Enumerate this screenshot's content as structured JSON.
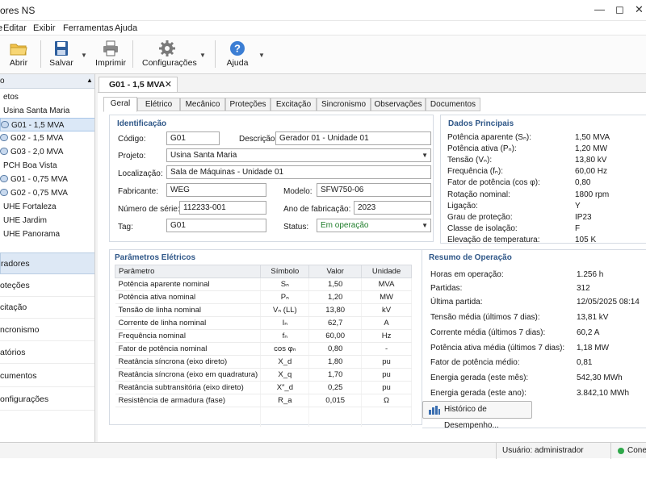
{
  "window": {
    "title": "ores NS"
  },
  "menu": [
    "Editar",
    "Exibir",
    "Ferramentas",
    "Ajuda"
  ],
  "menu_partial": "e",
  "toolbar": {
    "abrir": "Abrir",
    "salvar": "Salvar",
    "imprimir": "Imprimir",
    "config": "Configurações",
    "ajuda": "Ajuda"
  },
  "sidebar": {
    "tree": [
      "etos",
      "Usina Santa Maria",
      "G01 - 1,5 MVA",
      "G02 - 1,5 MVA",
      "G03 - 2,0 MVA",
      "PCH Boa Vista",
      "G01 - 0,75 MVA",
      "G02 - 0,75 MVA",
      "UHE Fortaleza",
      "UHE Jardim",
      "UHE Panorama"
    ],
    "nav": [
      "radores",
      "oteções",
      "citação",
      "ncronismo",
      "atórios",
      "cumentos",
      "onfigurações"
    ]
  },
  "doc_tab": {
    "label": "G01 - 1,5 MVA"
  },
  "tabs": [
    "Geral",
    "Elétrico",
    "Mecânico",
    "Proteções",
    "Excitação",
    "Sincronismo",
    "Observações",
    "Documentos"
  ],
  "identificacao": {
    "title": "Identificação",
    "codigo_label": "Código:",
    "codigo": "G01",
    "descricao_label": "Descrição:",
    "descricao": "Gerador 01 - Unidade 01",
    "projeto_label": "Projeto:",
    "projeto": "Usina Santa Maria",
    "localizacao_label": "Localização:",
    "localizacao": "Sala de Máquinas - Unidade 01",
    "fabricante_label": "Fabricante:",
    "fabricante": "WEG",
    "modelo_label": "Modelo:",
    "modelo": "SFW750-06",
    "serie_label": "Número de série:",
    "serie": "112233-001",
    "ano_label": "Ano de fabricação:",
    "ano": "2023",
    "tag_label": "Tag:",
    "tag": "G01",
    "status_label": "Status:",
    "status": "Em operação"
  },
  "dados": {
    "title": "Dados Principais",
    "rows": [
      [
        "Potência aparente (Sₙ):",
        "1,50  MVA"
      ],
      [
        "Potência ativa (Pₙ):",
        "1,20  MW"
      ],
      [
        "Tensão (Vₙ):",
        "13,80  kV"
      ],
      [
        "Frequência (fₙ):",
        "60,00  Hz"
      ],
      [
        "Fator de potência (cos φ):",
        "0,80"
      ],
      [
        "Rotação nominal:",
        "1800  rpm"
      ],
      [
        "Ligação:",
        "Y"
      ],
      [
        "Grau de proteção:",
        "IP23"
      ],
      [
        "Classe de isolação:",
        "F"
      ],
      [
        "Elevação de temperatura:",
        "105  K"
      ]
    ]
  },
  "parametros": {
    "title": "Parâmetros Elétricos",
    "headers": [
      "Parâmetro",
      "Símbolo",
      "Valor",
      "Unidade"
    ],
    "rows": [
      [
        "Potência aparente nominal",
        "Sₙ",
        "1,50",
        "MVA"
      ],
      [
        "Potência ativa nominal",
        "Pₙ",
        "1,20",
        "MW"
      ],
      [
        "Tensão de linha nominal",
        "Vₙ (LL)",
        "13,80",
        "kV"
      ],
      [
        "Corrente de linha nominal",
        "Iₙ",
        "62,7",
        "A"
      ],
      [
        "Frequência nominal",
        "fₙ",
        "60,00",
        "Hz"
      ],
      [
        "Fator de potência nominal",
        "cos φₙ",
        "0,80",
        "-"
      ],
      [
        "Reatância síncrona (eixo direto)",
        "X_d",
        "1,80",
        "pu"
      ],
      [
        "Reatância síncrona (eixo em quadratura)",
        "X_q",
        "1,70",
        "pu"
      ],
      [
        "Reatância subtransitória (eixo direto)",
        "X″_d",
        "0,25",
        "pu"
      ],
      [
        "Resistência de armadura (fase)",
        "R_a",
        "0,015",
        "Ω"
      ]
    ]
  },
  "resumo": {
    "title": "Resumo de Operação",
    "rows": [
      [
        "Horas em operação:",
        "1.256  h"
      ],
      [
        "Partidas:",
        "312"
      ],
      [
        "Última partida:",
        "12/05/2025  08:14"
      ],
      [
        "Tensão média (últimos 7 dias):",
        "13,81  kV"
      ],
      [
        "Corrente média (últimos 7 dias):",
        "60,2  A"
      ],
      [
        "Potência ativa média (últimos 7 dias):",
        "1,18  MW"
      ],
      [
        "Fator de potência médio:",
        "0,81"
      ],
      [
        "Energia gerada (este mês):",
        "542,30  MWh"
      ],
      [
        "Energia gerada (este ano):",
        "3.842,10  MWh"
      ]
    ],
    "button": "Histórico de Desempenho..."
  },
  "status": {
    "user": "Usuário: administrador",
    "conn": "Conec"
  },
  "colors": {
    "accent": "#2f5788",
    "ok": "#1e7d2a",
    "selection": "#dbe8f7"
  }
}
